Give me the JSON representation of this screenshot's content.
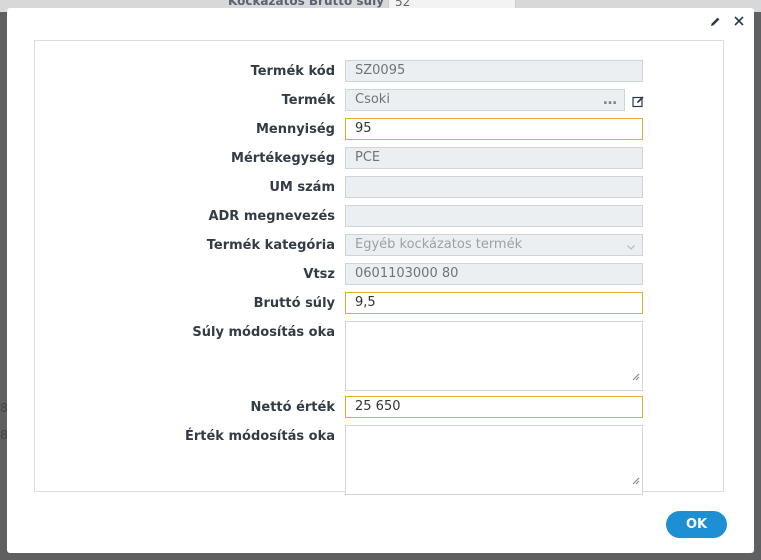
{
  "background": {
    "header_label": "Kockázatos Bruttó súly",
    "header_value": "52",
    "left_fragments": [
      "8",
      "8"
    ]
  },
  "modal": {
    "actions": {
      "edit_icon": "pencil-icon",
      "close_icon": "close-icon"
    },
    "fields": [
      {
        "label": "Termék kód",
        "value": "SZ0095",
        "editable": false
      },
      {
        "label": "Termék",
        "value": "Csoki",
        "editable": false,
        "picker": "…"
      },
      {
        "label": "Mennyiség",
        "value": "95",
        "editable": true
      },
      {
        "label": "Mértékegység",
        "value": "PCE",
        "editable": false
      },
      {
        "label": "UM szám",
        "value": "",
        "editable": false
      },
      {
        "label": "ADR megnevezés",
        "value": "",
        "editable": false
      },
      {
        "label": "Termék kategória",
        "value": "Egyéb kockázatos termék",
        "editable": false
      },
      {
        "label": "Vtsz",
        "value": "0601103000 80",
        "editable": false
      },
      {
        "label": "Bruttó súly",
        "value": "9,5",
        "editable": true
      },
      {
        "label": "Súly módosítás oka",
        "value": "",
        "editable": true
      },
      {
        "label": "Nettó érték",
        "value": "25 650",
        "editable": true
      },
      {
        "label": "Érték módosítás oka",
        "value": "",
        "editable": true
      }
    ],
    "ok_label": "OK"
  },
  "colors": {
    "accent": "#1f8fd4",
    "focus_border": "#e8a92f",
    "readonly_bg": "#eceff1",
    "overlay": "#5f6062"
  }
}
